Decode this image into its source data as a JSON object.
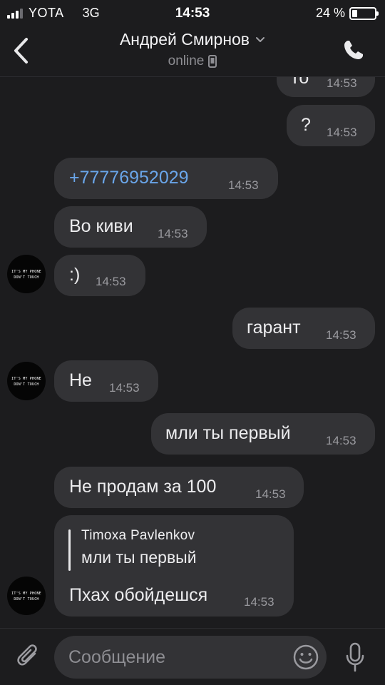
{
  "status_bar": {
    "carrier": "YOTA",
    "network": "3G",
    "time": "14:53",
    "battery": "24 %",
    "battery_level": 0.24,
    "signal_bars": 3
  },
  "header": {
    "contact_name": "Андрей Смирнов",
    "status": "online"
  },
  "avatar_text": [
    "IT'S MY PHONE",
    "DON'T TOUCH"
  ],
  "messages": [
    {
      "dir": "out",
      "text": "То",
      "time": "14:53"
    },
    {
      "dir": "out",
      "text": "?",
      "time": "14:53"
    },
    {
      "dir": "in",
      "text": "+77776952029",
      "time": "14:53",
      "link": true
    },
    {
      "dir": "in",
      "text": "Во киви",
      "time": "14:53"
    },
    {
      "dir": "in",
      "text": ":)",
      "time": "14:53"
    },
    {
      "dir": "out",
      "text": "гарант",
      "time": "14:53"
    },
    {
      "dir": "in",
      "text": "Не",
      "time": "14:53"
    },
    {
      "dir": "out",
      "text": "мли ты первый",
      "time": "14:53"
    },
    {
      "dir": "in",
      "text": "Не продам за 100",
      "time": "14:53"
    },
    {
      "dir": "in",
      "text": "Пхах обойдешся",
      "time": "14:53",
      "reply_to": {
        "author": "Timoxa Pavlenkov",
        "text": "мли ты первый"
      }
    }
  ],
  "composer": {
    "placeholder": "Сообщение"
  },
  "colors": {
    "background": "#1c1c1e",
    "bubble": "#333336",
    "link": "#6aa6ea",
    "secondary_text": "#8e8e93"
  }
}
